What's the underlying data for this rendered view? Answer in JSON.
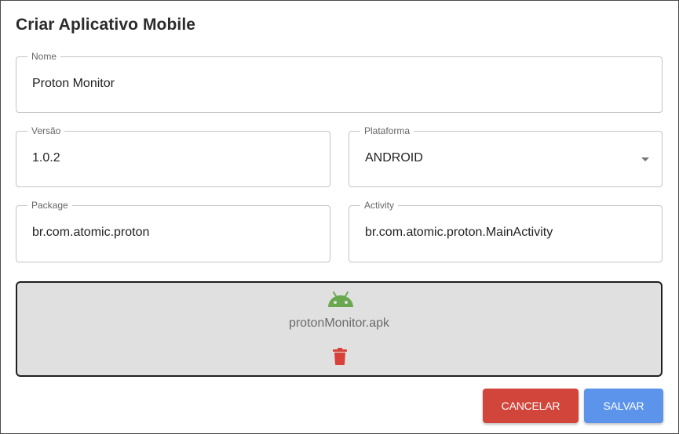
{
  "dialog": {
    "title": "Criar Aplicativo Mobile"
  },
  "fields": {
    "nome": {
      "label": "Nome",
      "value": "Proton Monitor"
    },
    "versao": {
      "label": "Versão",
      "value": "1.0.2"
    },
    "plataforma": {
      "label": "Plataforma",
      "value": "ANDROID"
    },
    "package": {
      "label": "Package",
      "value": "br.com.atomic.proton"
    },
    "activity": {
      "label": "Activity",
      "value": "br.com.atomic.proton.MainActivity"
    }
  },
  "upload": {
    "file_name": "protonMonitor.apk",
    "file_icon": "android-icon",
    "delete_icon": "trash-icon"
  },
  "actions": {
    "cancel_label": "CANCELAR",
    "save_label": "SALVAR"
  },
  "colors": {
    "cancel": "#d2453a",
    "save": "#5c94ec",
    "android": "#6aa84f",
    "delete": "#d8403a"
  }
}
